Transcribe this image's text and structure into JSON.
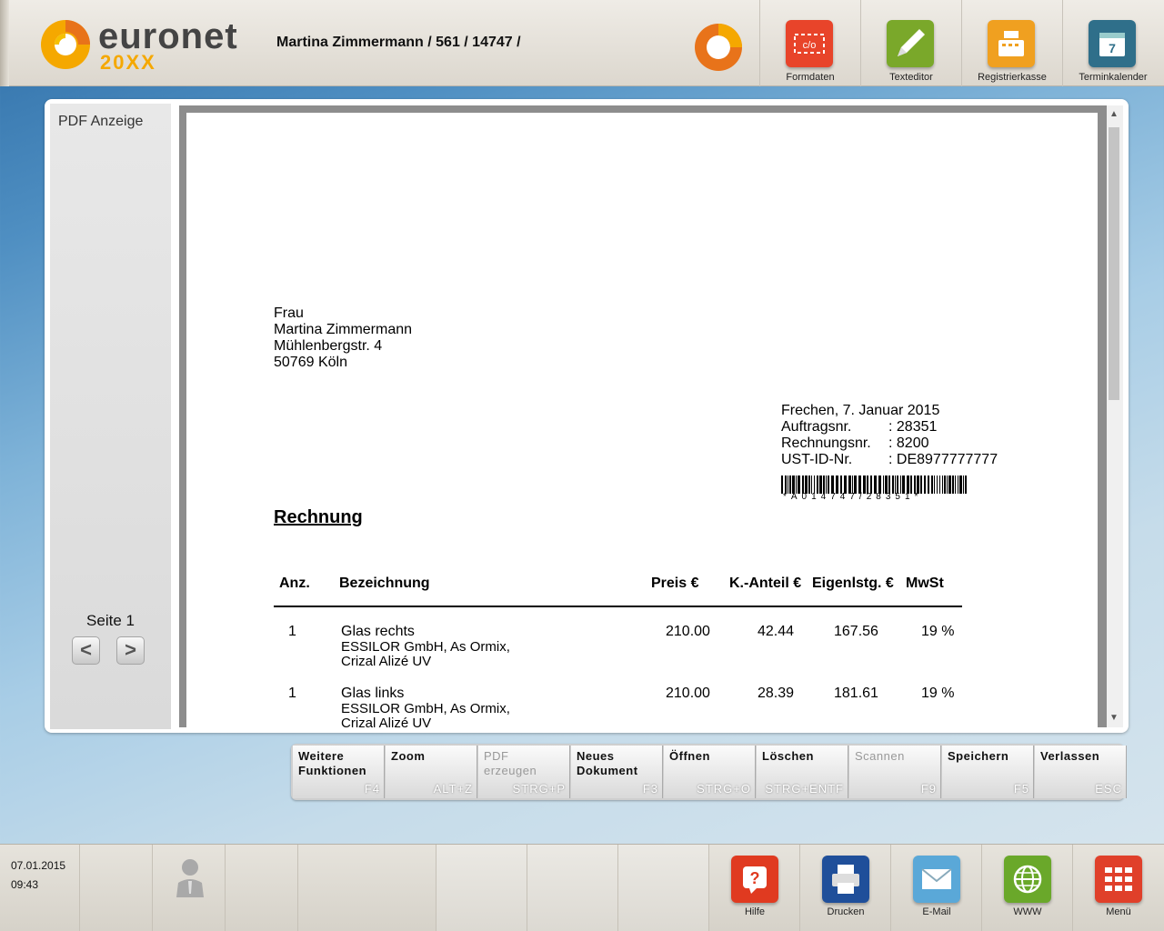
{
  "header": {
    "logo_text": "euronet",
    "logo_sub": "20XX",
    "user_info": "Martina Zimmermann / 561 / 14747 /",
    "buttons": [
      {
        "label": "Formdaten",
        "icon": "formdaten-icon",
        "color": "#e8442a"
      },
      {
        "label": "Texteditor",
        "icon": "pencil-icon",
        "color": "#7aa82a"
      },
      {
        "label": "Registrierkasse",
        "icon": "cash-register-icon",
        "color": "#f0a020"
      },
      {
        "label": "Terminkalender",
        "icon": "calendar-icon",
        "color": "#2f6f8a"
      }
    ]
  },
  "sidebar": {
    "title": "PDF Anzeige",
    "page_label": "Seite 1",
    "prev": "<",
    "next": ">"
  },
  "document": {
    "address": [
      "Frau",
      "Martina Zimmermann",
      "Mühlenbergstr. 4",
      "50769 Köln"
    ],
    "date_line": "Frechen, 7. Januar 2015",
    "meta": [
      {
        "label": "Auftragsnr.",
        "value": ": 28351"
      },
      {
        "label": "Rechnungsnr.",
        "value": ": 8200"
      },
      {
        "label": "UST-ID-Nr.",
        "value": ": DE8977777777"
      }
    ],
    "barcode_text": "*A014747/28351*",
    "title": "Rechnung",
    "columns": [
      "Anz.",
      "Bezeichnung",
      "Preis €",
      "K.-Anteil €",
      "Eigenlstg. €",
      "MwSt"
    ],
    "rows": [
      {
        "qty": "1",
        "name": "Glas rechts",
        "desc1": "ESSILOR GmbH, As Ormix,",
        "desc2": "Crizal Alizé UV",
        "price": "210.00",
        "kanteil": "42.44",
        "eigen": "167.56",
        "mwst": "19 %"
      },
      {
        "qty": "1",
        "name": "Glas links",
        "desc1": "ESSILOR GmbH, As Ormix,",
        "desc2": "Crizal Alizé UV",
        "price": "210.00",
        "kanteil": "28.39",
        "eigen": "181.61",
        "mwst": "19 %"
      }
    ]
  },
  "toolbar": [
    {
      "l1": "Weitere",
      "l2": "Funktionen",
      "key": "F4",
      "enabled": true
    },
    {
      "l1": "Zoom",
      "l2": "",
      "key": "ALT+Z",
      "enabled": true
    },
    {
      "l1": "PDF",
      "l2": "erzeugen",
      "key": "STRG+P",
      "enabled": false
    },
    {
      "l1": "Neues",
      "l2": "Dokument",
      "key": "F3",
      "enabled": true
    },
    {
      "l1": "Öffnen",
      "l2": "",
      "key": "STRG+O",
      "enabled": true
    },
    {
      "l1": "Löschen",
      "l2": "",
      "key": "STRG+ENTF",
      "enabled": true
    },
    {
      "l1": "Scannen",
      "l2": "",
      "key": "F9",
      "enabled": false
    },
    {
      "l1": "Speichern",
      "l2": "",
      "key": "F5",
      "enabled": true
    },
    {
      "l1": "Verlassen",
      "l2": "",
      "key": "ESC",
      "enabled": true
    }
  ],
  "footer": {
    "date": "07.01.2015",
    "time": "09:43",
    "buttons": [
      {
        "label": "Hilfe",
        "icon": "help-icon",
        "color": "#e03a20"
      },
      {
        "label": "Drucken",
        "icon": "printer-icon",
        "color": "#1f4f9a"
      },
      {
        "label": "E-Mail",
        "icon": "mail-icon",
        "color": "#5aa8d8"
      },
      {
        "label": "WWW",
        "icon": "globe-icon",
        "color": "#6aa82a"
      },
      {
        "label": "Menü",
        "icon": "menu-grid-icon",
        "color": "#e0402a"
      }
    ]
  }
}
